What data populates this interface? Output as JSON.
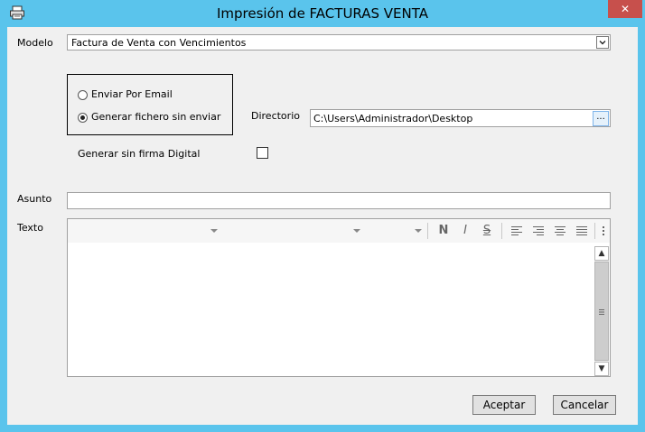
{
  "window": {
    "title": "Impresión de FACTURAS VENTA",
    "close_glyph": "✕",
    "accent_color": "#5ac4ec",
    "close_color": "#c7504c"
  },
  "form": {
    "modelo_label": "Modelo",
    "modelo_value": "Factura de Venta con Vencimientos",
    "options": {
      "email_label": "Enviar Por Email",
      "generate_label": "Generar fichero sin enviar",
      "selected": "generate"
    },
    "directorio_label": "Directorio",
    "directorio_value": "C:\\Users\\Administrador\\Desktop",
    "browse_label": "...",
    "firma_label": "Generar sin firma Digital",
    "firma_checked": false,
    "asunto_label": "Asunto",
    "asunto_value": "",
    "texto_label": "Texto"
  },
  "editor_toolbar": {
    "bold": "N",
    "italic": "I",
    "strike": "S",
    "icons": [
      "align-left-icon",
      "align-right-icon",
      "align-center-icon",
      "justify-icon",
      "more-icon"
    ]
  },
  "buttons": {
    "accept": "Aceptar",
    "cancel": "Cancelar"
  }
}
